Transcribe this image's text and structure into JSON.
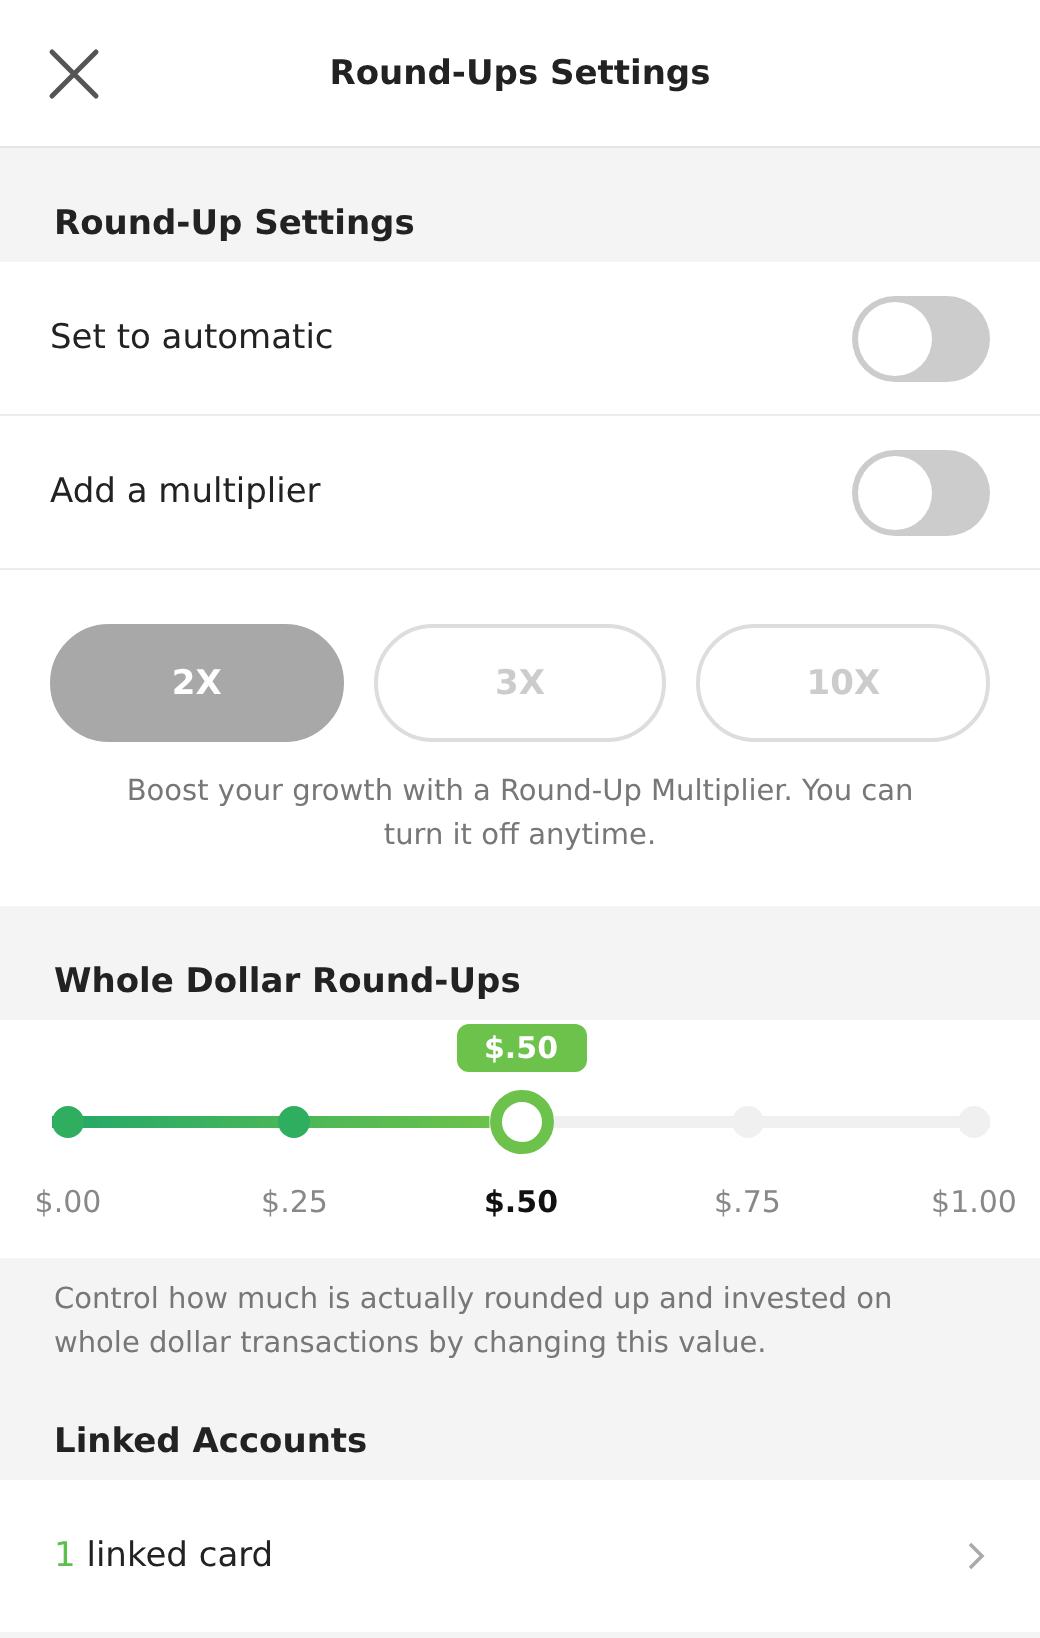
{
  "header": {
    "title": "Round-Ups Settings"
  },
  "round_up_settings": {
    "heading": "Round-Up Settings",
    "rows": [
      {
        "label": "Set to automatic",
        "on": false
      },
      {
        "label": "Add a multiplier",
        "on": false
      }
    ]
  },
  "multiplier": {
    "disabled": true,
    "options": [
      {
        "label": "2X",
        "selected": true
      },
      {
        "label": "3X",
        "selected": false
      },
      {
        "label": "10X",
        "selected": false
      }
    ],
    "note": "Boost your growth with a Round-Up Multiplier. You can turn it off anytime."
  },
  "whole_dollar": {
    "heading": "Whole Dollar Round-Ups",
    "bubble": "$.50",
    "level": 0.5,
    "stops": [
      {
        "label": "$.00",
        "selected": false
      },
      {
        "label": "$.25",
        "selected": false
      },
      {
        "label": "$.50",
        "selected": true
      },
      {
        "label": "$.75",
        "selected": false
      },
      {
        "label": "$1.00",
        "selected": false
      }
    ],
    "note": "Control how much is actually rounded up and invested on whole dollar transactions by changing this value."
  },
  "linked_accounts": {
    "heading": "Linked Accounts",
    "count": "1",
    "label": "linked card"
  }
}
